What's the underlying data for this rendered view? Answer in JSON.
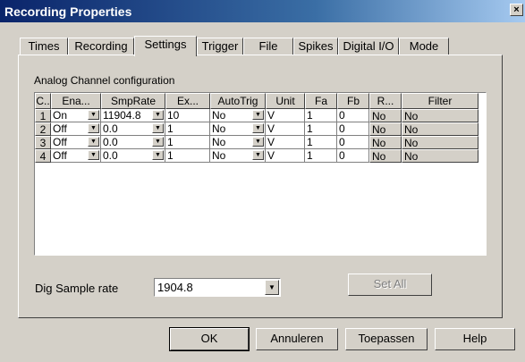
{
  "window": {
    "title": "Recording Properties",
    "close_glyph": "×"
  },
  "tabs": [
    {
      "label": "Times"
    },
    {
      "label": "Recording"
    },
    {
      "label": "Settings"
    },
    {
      "label": "Trigger"
    },
    {
      "label": "File"
    },
    {
      "label": "Spikes"
    },
    {
      "label": "Digital I/O"
    },
    {
      "label": "Mode"
    }
  ],
  "active_tab": "Settings",
  "group_label": "Analog Channel configuration",
  "grid": {
    "headers": [
      "C..",
      "Ena...",
      "SmpRate",
      "Ex...",
      "AutoTrig",
      "Unit",
      "Fa",
      "Fb",
      "R...",
      "Filter"
    ],
    "rows": [
      {
        "ch": "1",
        "enable": "On",
        "smprate": "11904.8",
        "ex": "10",
        "autotrig": "No",
        "unit": "V",
        "fa": "1",
        "fb": "0",
        "r": "No",
        "filter": "No"
      },
      {
        "ch": "2",
        "enable": "Off",
        "smprate": "0.0",
        "ex": "1",
        "autotrig": "No",
        "unit": "V",
        "fa": "1",
        "fb": "0",
        "r": "No",
        "filter": "No"
      },
      {
        "ch": "3",
        "enable": "Off",
        "smprate": "0.0",
        "ex": "1",
        "autotrig": "No",
        "unit": "V",
        "fa": "1",
        "fb": "0",
        "r": "No",
        "filter": "No"
      },
      {
        "ch": "4",
        "enable": "Off",
        "smprate": "0.0",
        "ex": "1",
        "autotrig": "No",
        "unit": "V",
        "fa": "1",
        "fb": "0",
        "r": "No",
        "filter": "No"
      }
    ]
  },
  "dig_sample": {
    "label": "Dig Sample rate",
    "value": "1904.8"
  },
  "buttons": {
    "set_all": "Set All",
    "ok": "OK",
    "cancel": "Annuleren",
    "apply": "Toepassen",
    "help": "Help"
  }
}
